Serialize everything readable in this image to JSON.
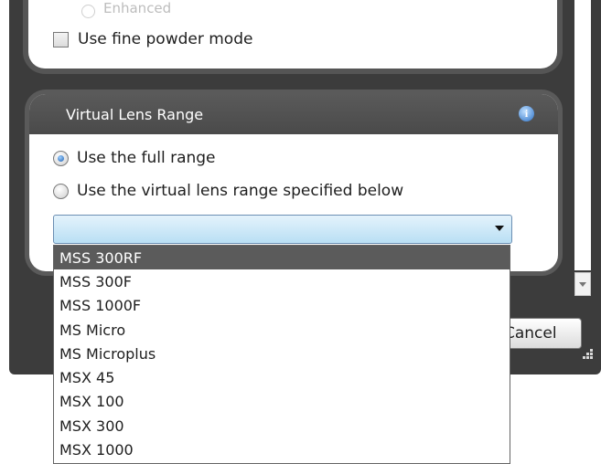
{
  "top_section": {
    "enhanced_label": "Enhanced",
    "fine_powder_label": "Use fine powder mode"
  },
  "lens_group": {
    "title": "Virtual Lens Range",
    "info_icon": "i",
    "full_range_label": "Use the full range",
    "specified_range_label": "Use the virtual lens range specified below",
    "selected_option": "full_range"
  },
  "footer": {
    "cancel_label": "Cancel"
  },
  "dropdown": {
    "items": [
      "MSS 300RF",
      "MSS 300F",
      "MSS 1000F",
      "MS Micro",
      "MS Microplus",
      "MSX 45",
      "MSX 100",
      "MSX 300",
      "MSX 1000"
    ],
    "highlighted": "MSS 300RF"
  }
}
